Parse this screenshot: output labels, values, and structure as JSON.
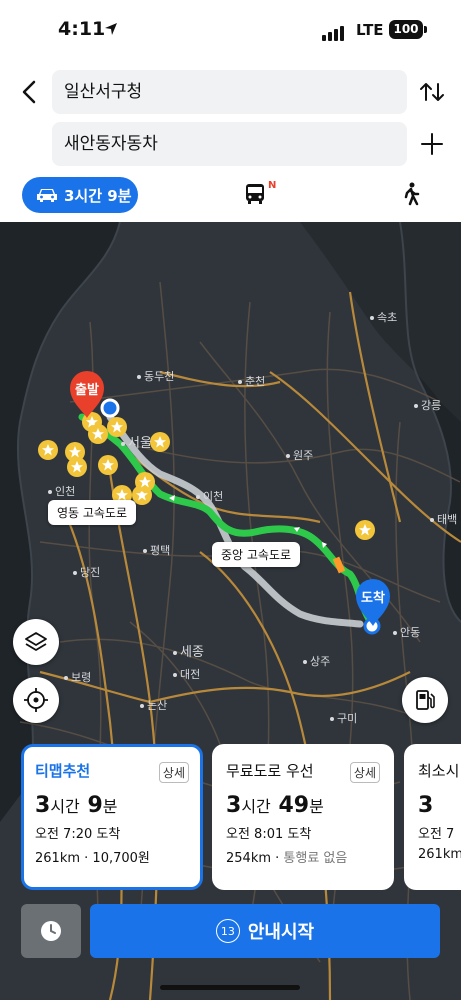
{
  "status": {
    "time": "4:11",
    "network": "LTE",
    "battery": "100"
  },
  "search": {
    "origin": "일산서구청",
    "destination": "새안동자동차"
  },
  "modes": {
    "car_label": "3시간 9분",
    "bus_badge": "N"
  },
  "map": {
    "cities": [
      "속초",
      "동두천",
      "춘천",
      "강릉",
      "서울",
      "인천",
      "이천",
      "원주",
      "평택",
      "태백",
      "당진",
      "안동",
      "세종",
      "대전",
      "보령",
      "논산",
      "상주",
      "구미"
    ],
    "road_labels": [
      "영동 고속도로",
      "중앙 고속도로"
    ],
    "start_pin": "출발",
    "end_pin": "도착"
  },
  "routes": [
    {
      "name": "티맵추천",
      "detail": "상세",
      "hours": "3",
      "hours_unit": "시간",
      "minutes": "9",
      "minutes_unit": "분",
      "arrival": "오전 7:20 도착",
      "distance": "261km",
      "toll": "10,700원"
    },
    {
      "name": "무료도로 우선",
      "detail": "상세",
      "hours": "3",
      "hours_unit": "시간",
      "minutes": "49",
      "minutes_unit": "분",
      "arrival": "오전 8:01 도착",
      "distance": "254km",
      "toll": "통행료 없음"
    },
    {
      "name": "최소시",
      "hours": "3",
      "arrival": "오전 7",
      "distance": "261km"
    }
  ],
  "start_button": {
    "badge": "13",
    "label": "안내시작"
  }
}
